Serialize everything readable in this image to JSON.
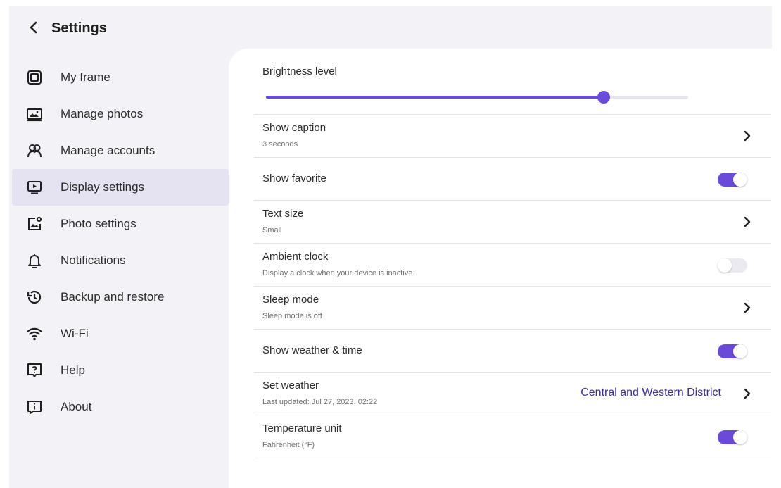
{
  "header": {
    "title": "Settings"
  },
  "sidebar": {
    "items": [
      {
        "label": "My frame",
        "icon": "frame-icon"
      },
      {
        "label": "Manage photos",
        "icon": "photos-icon"
      },
      {
        "label": "Manage accounts",
        "icon": "accounts-icon"
      },
      {
        "label": "Display settings",
        "icon": "display-icon",
        "active": true
      },
      {
        "label": "Photo settings",
        "icon": "photo-settings-icon"
      },
      {
        "label": "Notifications",
        "icon": "bell-icon"
      },
      {
        "label": "Backup and restore",
        "icon": "backup-icon"
      },
      {
        "label": "Wi-Fi",
        "icon": "wifi-icon"
      },
      {
        "label": "Help",
        "icon": "help-icon"
      },
      {
        "label": "About",
        "icon": "info-icon"
      }
    ]
  },
  "display": {
    "brightness": {
      "label": "Brightness level",
      "value": 0.8
    },
    "rows": {
      "show_caption": {
        "title": "Show caption",
        "subtitle": "3 seconds"
      },
      "show_favorite": {
        "title": "Show favorite",
        "enabled": true
      },
      "text_size": {
        "title": "Text size",
        "subtitle": "Small"
      },
      "ambient_clock": {
        "title": "Ambient clock",
        "subtitle": "Display a clock when your device is inactive.",
        "enabled": false
      },
      "sleep_mode": {
        "title": "Sleep mode",
        "subtitle": "Sleep mode is off"
      },
      "show_weather": {
        "title": "Show weather & time",
        "enabled": true
      },
      "set_weather": {
        "title": "Set weather",
        "subtitle": "Last updated: Jul 27, 2023, 02:22",
        "value": "Central and Western District"
      },
      "temperature_unit": {
        "title": "Temperature unit",
        "subtitle": "Fahrenheit (°F)",
        "enabled": true
      }
    }
  },
  "colors": {
    "accent": "#6a4ad8",
    "active_bg": "#e5e2f2",
    "value_text": "#3a2f8f"
  }
}
